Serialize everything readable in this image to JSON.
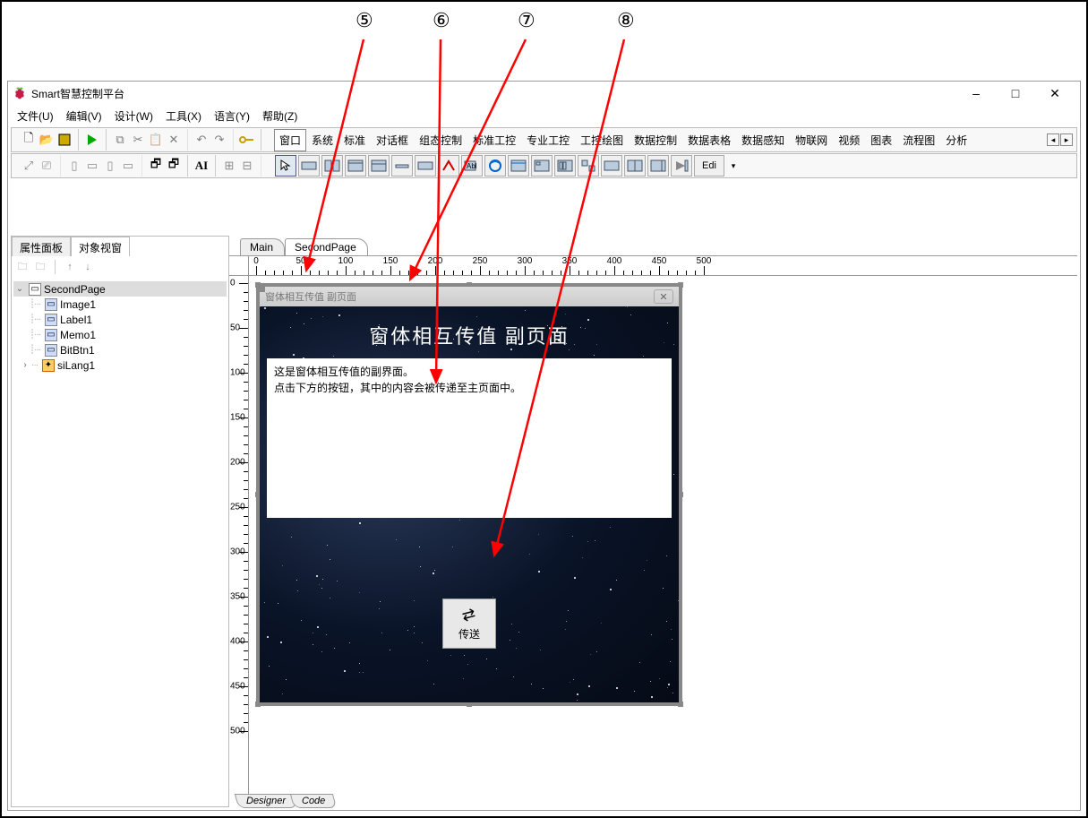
{
  "app_title": "Smart智慧控制平台",
  "window_controls": {
    "min": "–",
    "max": "□",
    "close": "✕"
  },
  "menubar": [
    "文件(U)",
    "编辑(V)",
    "设计(W)",
    "工具(X)",
    "语言(Y)",
    "帮助(Z)"
  ],
  "palette_tabs": [
    "窗口",
    "系统",
    "标准",
    "对话框",
    "组态控制",
    "标准工控",
    "专业工控",
    "工控绘图",
    "数据控制",
    "数据表格",
    "数据感知",
    "物联网",
    "视频",
    "图表",
    "流程图",
    "分析"
  ],
  "palette_active": "窗口",
  "left_tabs": [
    "属性面板",
    "对象视窗"
  ],
  "left_tab_active": "对象视窗",
  "tree": {
    "root": "SecondPage",
    "children": [
      "Image1",
      "Label1",
      "Memo1",
      "BitBtn1",
      "siLang1"
    ]
  },
  "page_tabs": [
    "Main",
    "SecondPage"
  ],
  "page_tab_active": "SecondPage",
  "ruler_max_h": 460,
  "ruler_max_v": 460,
  "form": {
    "caption": "窗体相互传值 副页面",
    "heading": "窗体相互传值 副页面",
    "memo_line1": "这是窗体相互传值的副界面。",
    "memo_line2": "点击下方的按钮，其中的内容会被传递至主页面中。",
    "button_label": "传送"
  },
  "bottom_tabs": [
    "Designer",
    "Code"
  ],
  "annotations": [
    "⑤",
    "⑥",
    "⑦",
    "⑧"
  ],
  "edit_label": "Edi"
}
